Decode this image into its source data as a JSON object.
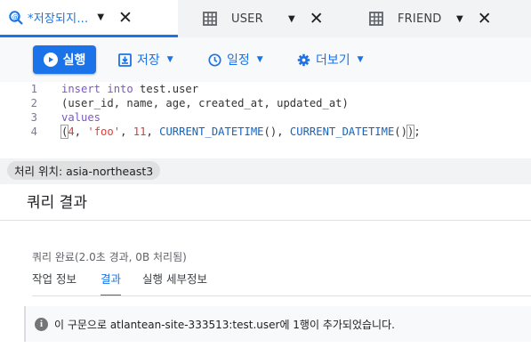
{
  "tabs": [
    {
      "label": "*저장되지...",
      "icon": "query-search-icon",
      "active": true
    },
    {
      "label": "USER",
      "icon": "table-icon",
      "active": false
    },
    {
      "label": "FRIEND",
      "icon": "table-icon",
      "active": false
    }
  ],
  "toolbar": {
    "run_label": "실행",
    "save_label": "저장",
    "schedule_label": "일정",
    "more_label": "더보기"
  },
  "editor": {
    "lines": [
      {
        "no": "1",
        "text": "insert into test.user"
      },
      {
        "no": "2",
        "text": "(user_id, name, age, created_at, updated_at)"
      },
      {
        "no": "3",
        "text": "values"
      },
      {
        "no": "4",
        "text": "(4, 'foo', 11, CURRENT_DATETIME(), CURRENT_DATETIME());"
      }
    ]
  },
  "location": {
    "label": "처리 위치: asia-northeast3"
  },
  "results": {
    "title": "쿼리 결과",
    "status": "쿼리 완료(2.0초 경과, 0B 처리됨)",
    "subtabs": [
      {
        "label": "작업 정보",
        "active": false
      },
      {
        "label": "결과",
        "active": true
      },
      {
        "label": "실행 세부정보",
        "active": false
      }
    ],
    "message": "이 구문으로 atlantean-site-333513:test.user에 1행이 추가되었습니다."
  },
  "colors": {
    "accent": "#1a73e8",
    "keyword": "#7e57c2",
    "string": "#e53935",
    "function": "#1565c0"
  }
}
